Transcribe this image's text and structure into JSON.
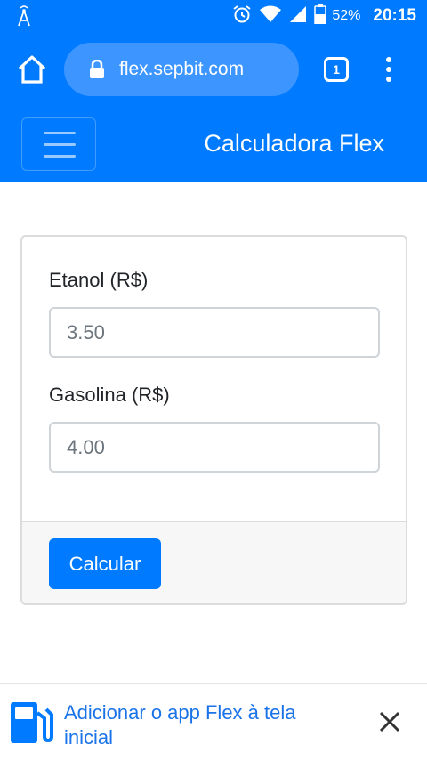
{
  "status_bar": {
    "battery": "52%",
    "time": "20:15"
  },
  "browser": {
    "url": "flex.sepbit.com",
    "tab_count": "1"
  },
  "navbar": {
    "brand": "Calculadora Flex"
  },
  "form": {
    "etanol_label": "Etanol (R$)",
    "etanol_placeholder": "3.50",
    "gasolina_label": "Gasolina (R$)",
    "gasolina_placeholder": "4.00",
    "submit_label": "Calcular"
  },
  "install_banner": {
    "text": "Adicionar o app Flex à tela inicial"
  },
  "colors": {
    "primary": "#007bff",
    "banner_text": "#1a73e8"
  }
}
